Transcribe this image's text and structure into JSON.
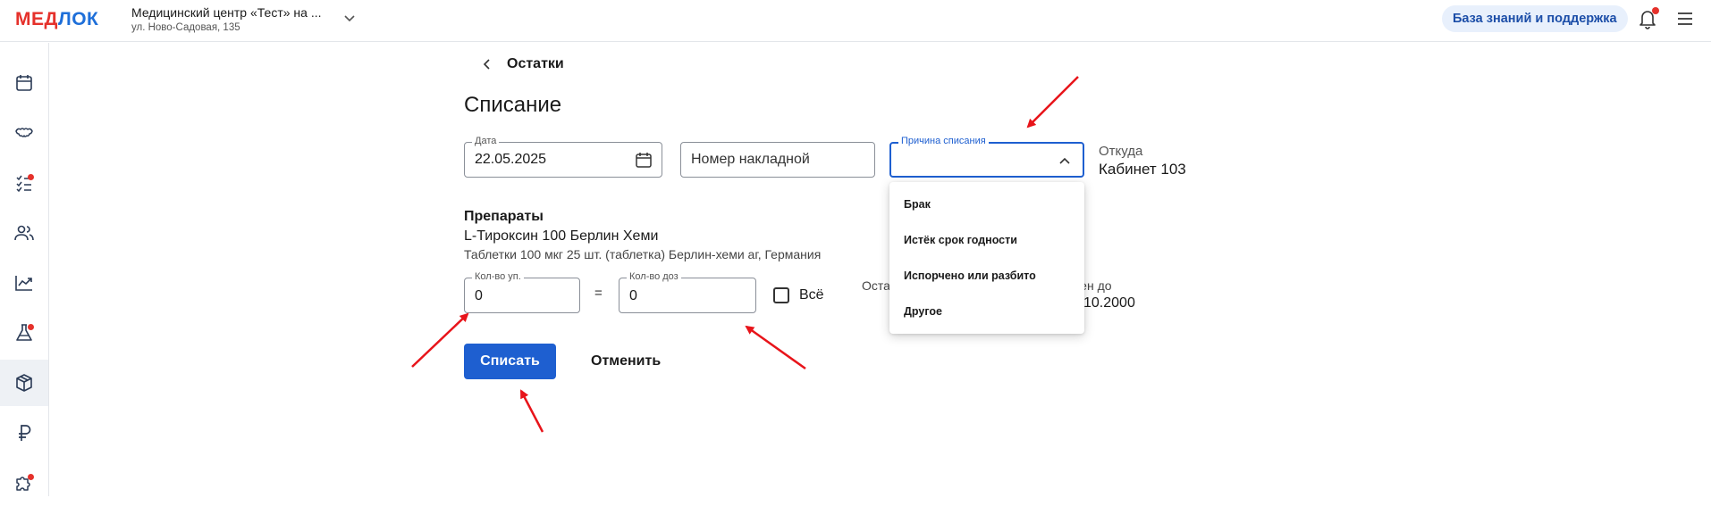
{
  "header": {
    "logo_part1": "МЕД",
    "logo_part2": "ЛОК",
    "clinic_name": "Медицинский центр «Тест» на ...",
    "clinic_address": "ул. Ново-Садовая, 135",
    "help_button": "База знаний и поддержка"
  },
  "sidebar": {
    "items": [
      {
        "icon": "calendar-icon",
        "badge": false
      },
      {
        "icon": "tooth-icon",
        "badge": false
      },
      {
        "icon": "checklist-icon",
        "badge": true
      },
      {
        "icon": "users-icon",
        "badge": false
      },
      {
        "icon": "chart-icon",
        "badge": false
      },
      {
        "icon": "flask-icon",
        "badge": true
      },
      {
        "icon": "box-icon",
        "badge": false,
        "active": true
      },
      {
        "icon": "ruble-icon",
        "badge": false
      },
      {
        "icon": "puzzle-icon",
        "badge": true
      }
    ]
  },
  "page": {
    "back_label": "Остатки",
    "title": "Списание"
  },
  "form": {
    "date_label": "Дата",
    "date_value": "22.05.2025",
    "invoice_placeholder": "Номер накладной",
    "reason_label": "Причина списания",
    "reason_value": "",
    "from_label": "Откуда",
    "from_value": "Кабинет 103"
  },
  "drugs": {
    "heading": "Препараты",
    "name": "L-Тироксин 100 Берлин Хеми",
    "description": "Таблетки 100 мкг 25 шт. (таблетка) Берлин-хеми аг, Германия",
    "packs_label": "Кол-во уп.",
    "packs_value": "0",
    "equals": "=",
    "doses_label": "Кол-во доз",
    "doses_value": "0",
    "all_label": "Всё",
    "rest_label_partial": "Оста",
    "valid_label_partial": "ден до",
    "valid_value_partial": "10.2000"
  },
  "actions": {
    "submit": "Списать",
    "cancel": "Отменить"
  },
  "reason_dropdown": {
    "options": [
      "Брак",
      "Истёк срок годности",
      "Испорчено или разбито",
      "Другое"
    ]
  },
  "colors": {
    "primary": "#1e5fd0",
    "logo_red": "#e5312b",
    "logo_blue": "#1e6fd9",
    "annotation_arrow": "#e8141a"
  }
}
